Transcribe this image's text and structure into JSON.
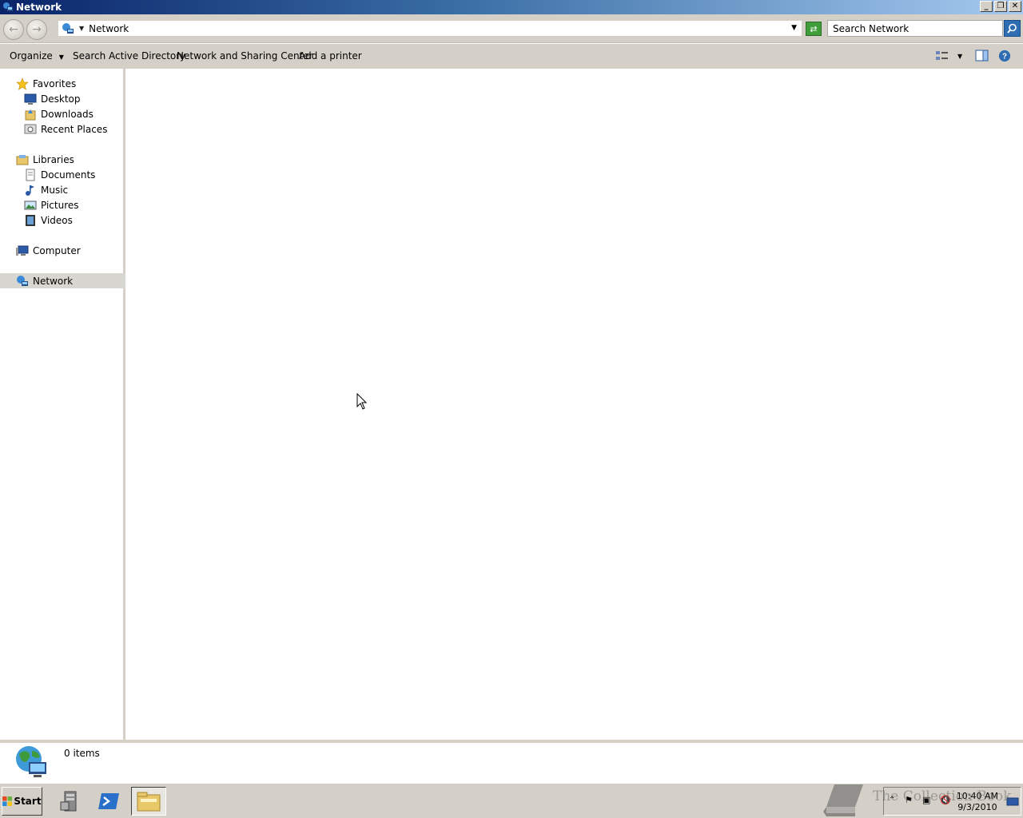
{
  "window": {
    "title": "Network"
  },
  "address": {
    "crumb": "Network"
  },
  "search": {
    "placeholder": "Search Network"
  },
  "commands": {
    "organize": "Organize",
    "search_ad": "Search Active Directory",
    "nsc": "Network and Sharing Center",
    "add_printer": "Add a printer"
  },
  "nav": {
    "favorites": {
      "label": "Favorites",
      "items": [
        "Desktop",
        "Downloads",
        "Recent Places"
      ]
    },
    "libraries": {
      "label": "Libraries",
      "items": [
        "Documents",
        "Music",
        "Pictures",
        "Videos"
      ]
    },
    "computer": "Computer",
    "network": "Network"
  },
  "status": {
    "items": "0 items"
  },
  "taskbar": {
    "start": "Start",
    "time": "10:40 AM",
    "date": "9/3/2010"
  },
  "watermark": {
    "text": "The Collection Book"
  }
}
